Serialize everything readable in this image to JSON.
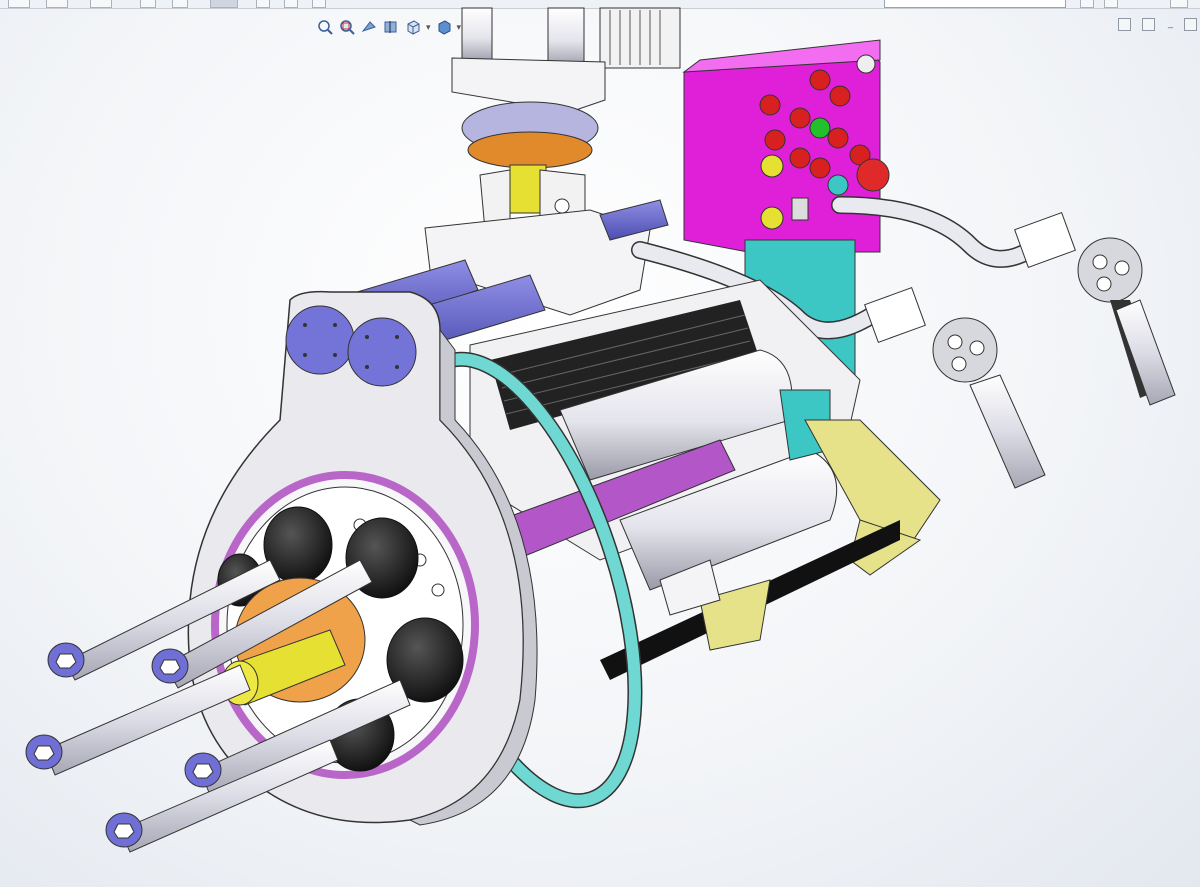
{
  "document": {
    "title": ""
  },
  "toolbar": {
    "buttons": [
      {
        "name": "new-document-button"
      },
      {
        "name": "open-button"
      },
      {
        "name": "print-button"
      },
      {
        "name": "undo-button"
      },
      {
        "name": "redo-button"
      },
      {
        "name": "select-button"
      },
      {
        "name": "rebuild-button"
      },
      {
        "name": "file-properties-button"
      },
      {
        "name": "options-button"
      }
    ]
  },
  "search": {
    "placeholder": ""
  },
  "heads_up_toolbar": {
    "icons": [
      "zoom-to-fit-icon",
      "zoom-to-area-icon",
      "previous-view-icon",
      "section-view-icon",
      "view-orientation-icon",
      "display-style-icon"
    ]
  },
  "window_controls": {
    "restore": "",
    "maximize": "",
    "minimize": "_"
  },
  "colors": {
    "plate": "#e9e9ee",
    "magenta_box": "#e020d8",
    "teal": "#3cc7c4",
    "rod_blue": "#6f6fd6",
    "yellow": "#e6e032",
    "orange": "#e08a2c",
    "purple_ring": "#b866c8",
    "dark": "#1a1a1a"
  }
}
